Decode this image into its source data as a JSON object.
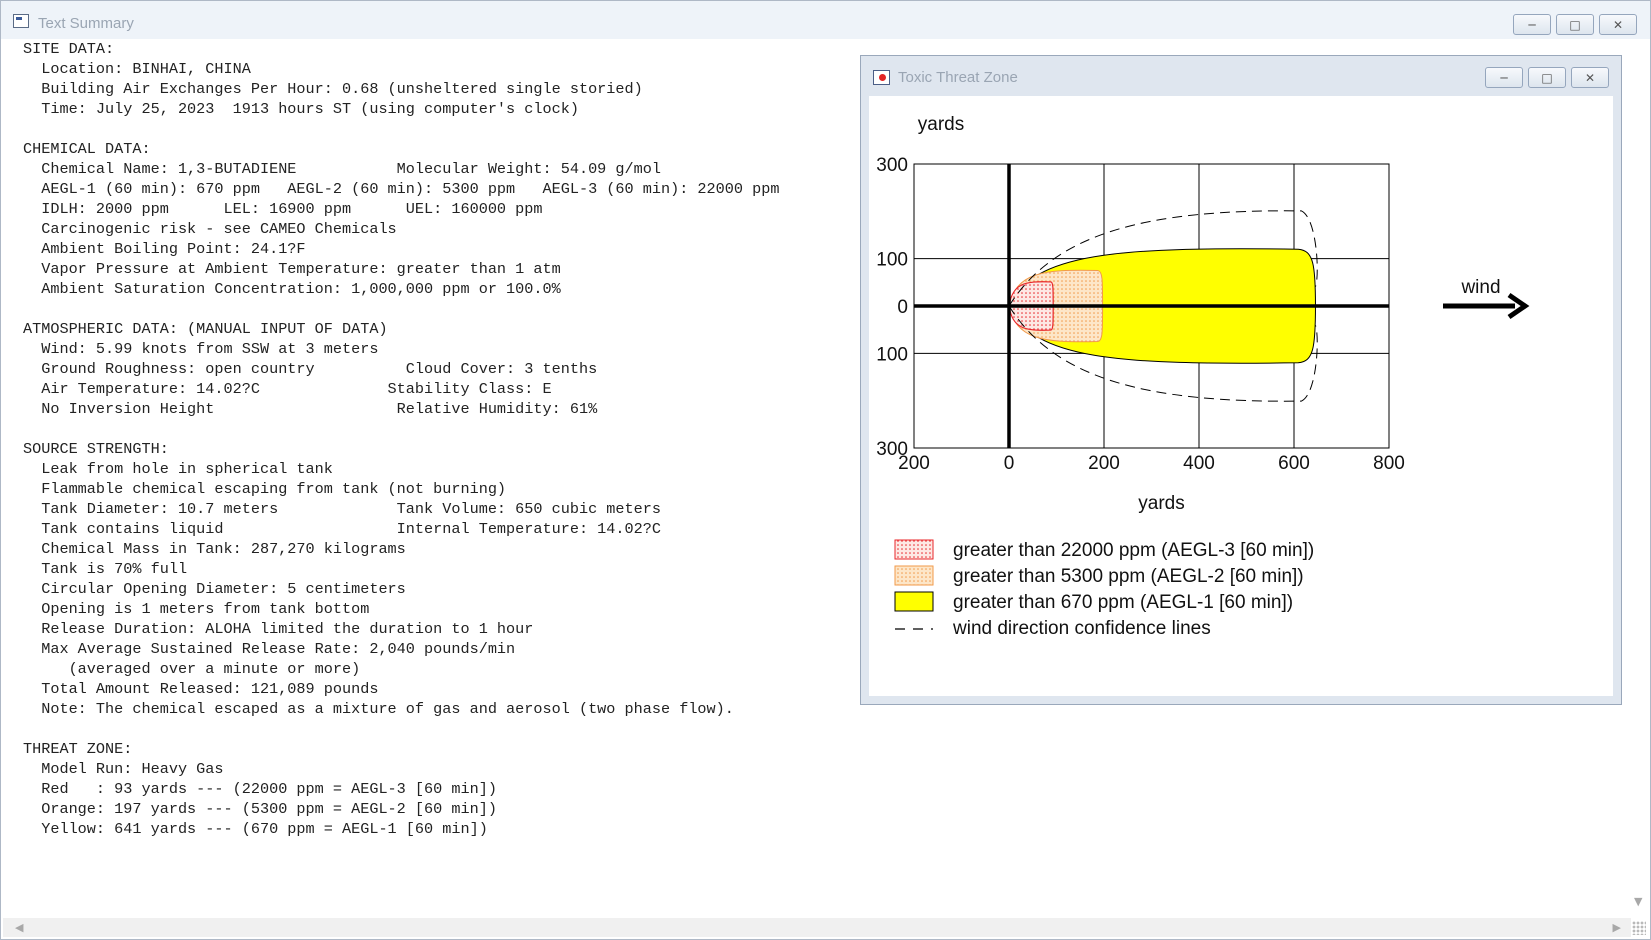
{
  "main_window": {
    "title": "Text Summary",
    "buttons": {
      "minimize": "─",
      "maximize": "□",
      "close": "✕"
    }
  },
  "report_lines": [
    "SITE DATA:",
    "  Location: BINHAI, CHINA",
    "  Building Air Exchanges Per Hour: 0.68 (unsheltered single storied)",
    "  Time: July 25, 2023  1913 hours ST (using computer's clock)",
    "",
    "CHEMICAL DATA:",
    "  Chemical Name: 1,3-BUTADIENE           Molecular Weight: 54.09 g/mol",
    "  AEGL-1 (60 min): 670 ppm   AEGL-2 (60 min): 5300 ppm   AEGL-3 (60 min): 22000 ppm",
    "  IDLH: 2000 ppm      LEL: 16900 ppm      UEL: 160000 ppm",
    "  Carcinogenic risk - see CAMEO Chemicals",
    "  Ambient Boiling Point: 24.1?F",
    "  Vapor Pressure at Ambient Temperature: greater than 1 atm",
    "  Ambient Saturation Concentration: 1,000,000 ppm or 100.0%",
    "",
    "ATMOSPHERIC DATA: (MANUAL INPUT OF DATA)",
    "  Wind: 5.99 knots from SSW at 3 meters",
    "  Ground Roughness: open country          Cloud Cover: 3 tenths",
    "  Air Temperature: 14.02?C              Stability Class: E",
    "  No Inversion Height                    Relative Humidity: 61%",
    "",
    "SOURCE STRENGTH:",
    "  Leak from hole in spherical tank",
    "  Flammable chemical escaping from tank (not burning)",
    "  Tank Diameter: 10.7 meters             Tank Volume: 650 cubic meters",
    "  Tank contains liquid                   Internal Temperature: 14.02?C",
    "  Chemical Mass in Tank: 287,270 kilograms",
    "  Tank is 70% full",
    "  Circular Opening Diameter: 5 centimeters",
    "  Opening is 1 meters from tank bottom",
    "  Release Duration: ALOHA limited the duration to 1 hour",
    "  Max Average Sustained Release Rate: 2,040 pounds/min",
    "     (averaged over a minute or more)",
    "  Total Amount Released: 121,089 pounds",
    "  Note: The chemical escaped as a mixture of gas and aerosol (two phase flow).",
    "",
    "THREAT ZONE:",
    "  Model Run: Heavy Gas",
    "  Red   : 93 yards --- (22000 ppm = AEGL-3 [60 min])",
    "  Orange: 197 yards --- (5300 ppm = AEGL-2 [60 min])",
    "  Yellow: 641 yards --- (670 ppm = AEGL-1 [60 min])"
  ],
  "threat_window": {
    "title": "Toxic Threat Zone",
    "buttons": {
      "minimize": "─",
      "maximize": "□",
      "close": "✕"
    }
  },
  "chart_data": {
    "type": "area",
    "y_unit_label": "yards",
    "xlabel": "yards",
    "x_ticks": [
      "200",
      "0",
      "200",
      "400",
      "600",
      "800"
    ],
    "x_tick_values": [
      -200,
      0,
      200,
      400,
      600,
      800
    ],
    "y_ticks": [
      "300",
      "100",
      "0",
      "100",
      "300"
    ],
    "y_tick_values": [
      300,
      100,
      0,
      -100,
      -300
    ],
    "xlim": [
      -200,
      800
    ],
    "ylim": [
      -300,
      300
    ],
    "grid": true,
    "wind_label": "wind",
    "zones": [
      {
        "name": "greater than 22000 ppm (AEGL-3 [60 min])",
        "distance": 93,
        "half_width": 53,
        "color": "#e8262a",
        "fill": "dots-red"
      },
      {
        "name": "greater than 5300 ppm (AEGL-2 [60 min])",
        "distance": 197,
        "half_width": 78,
        "color": "#f5a15a",
        "fill": "dots-orange"
      },
      {
        "name": "greater than 670 ppm (AEGL-1 [60 min])",
        "distance": 641,
        "half_width": 125,
        "color": "#ffff00",
        "fill": "solid"
      }
    ],
    "confidence_lines": {
      "name": "wind direction confidence lines",
      "distance": 641,
      "half_width": 205
    },
    "legend_position": "bottom"
  }
}
